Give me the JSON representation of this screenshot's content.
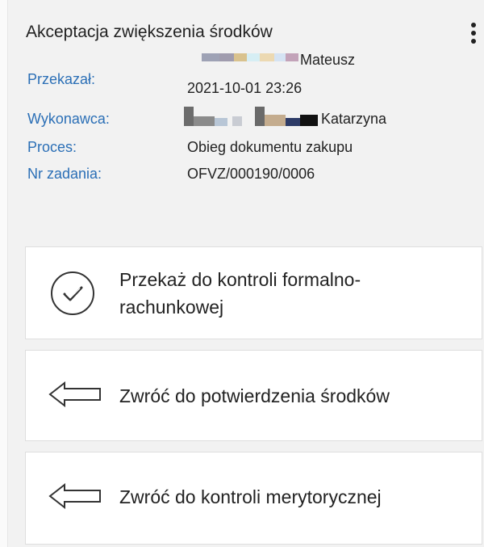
{
  "task": {
    "title": "Akceptacja zwiększenia środków",
    "fields": {
      "przekazal": {
        "label": "Przekazał:",
        "name": "Mateusz",
        "datetime": "2021-10-01 23:26"
      },
      "wykonawca": {
        "label": "Wykonawca:",
        "name": "Katarzyna"
      },
      "proces": {
        "label": "Proces:",
        "value": "Obieg dokumentu zakupu"
      },
      "nr_zadania": {
        "label": "Nr zadania:",
        "value": "OFVZ/000190/0006"
      }
    }
  },
  "actions": [
    {
      "icon": "check-circle-icon",
      "label_line1": "Przekaż do kontroli formalno-",
      "label_line2": "rachunkowej"
    },
    {
      "icon": "arrow-left-icon",
      "label": "Zwróć do potwierdzenia środków"
    },
    {
      "icon": "arrow-left-icon",
      "label": "Zwróć do kontroli merytorycznej"
    }
  ],
  "colors": {
    "label_blue": "#2b6fb6",
    "panel_bg": "#f2f2f2",
    "card_bg": "#ffffff"
  }
}
